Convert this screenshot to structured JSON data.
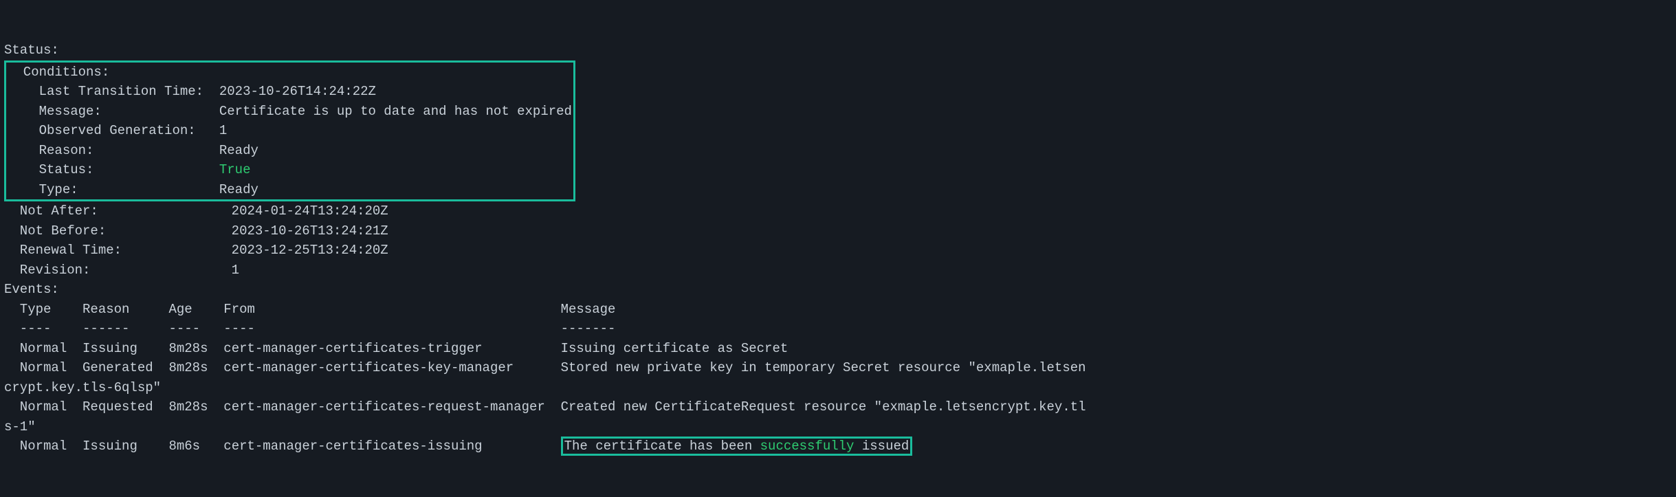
{
  "status_label": "Status:",
  "conditions": {
    "label": "  Conditions:",
    "last_transition_time": {
      "label": "    Last Transition Time:",
      "value": "2023-10-26T14:24:22Z"
    },
    "message": {
      "label": "    Message:",
      "value": "Certificate is up to date and has not expired"
    },
    "observed_generation": {
      "label": "    Observed Generation:",
      "value": "1"
    },
    "reason": {
      "label": "    Reason:",
      "value": "Ready"
    },
    "status_inner": {
      "label": "    Status:",
      "value": "True"
    },
    "type": {
      "label": "    Type:",
      "value": "Ready"
    }
  },
  "not_after": {
    "label": "  Not After:",
    "value": "2024-01-24T13:24:20Z"
  },
  "not_before": {
    "label": "  Not Before:",
    "value": "2023-10-26T13:24:21Z"
  },
  "renewal_time": {
    "label": "  Renewal Time:",
    "value": "2023-12-25T13:24:20Z"
  },
  "revision": {
    "label": "  Revision:",
    "value": "1"
  },
  "events": {
    "label": "Events:",
    "header": {
      "type": "  Type",
      "reason": "Reason",
      "age": "Age",
      "from": "From",
      "message": "Message"
    },
    "divider": {
      "type": "  ----",
      "reason": "------",
      "age": "----",
      "from": "----",
      "message": "-------"
    },
    "rows": [
      {
        "type": "  Normal",
        "reason": "Issuing",
        "age": "8m28s",
        "from": "cert-manager-certificates-trigger",
        "message": "Issuing certificate as Secret"
      },
      {
        "type": "  Normal",
        "reason": "Generated",
        "age": "8m28s",
        "from": "cert-manager-certificates-key-manager",
        "message_pre": "Stored new private key in temporary Secret resource \"exmaple.letsen",
        "message_wrap": "crypt.key.tls-6qlsp\""
      },
      {
        "type": "  Normal",
        "reason": "Requested",
        "age": "8m28s",
        "from": "cert-manager-certificates-request-manager",
        "message_pre": "Created new CertificateRequest resource \"exmaple.letsencrypt.key.tl",
        "message_wrap": "s-1\""
      },
      {
        "type": "  Normal",
        "reason": "Issuing",
        "age": "8m6s",
        "from": "cert-manager-certificates-issuing",
        "message_p1": "The certificate has been ",
        "message_green": "successfully",
        "message_p2": " issued"
      }
    ]
  }
}
